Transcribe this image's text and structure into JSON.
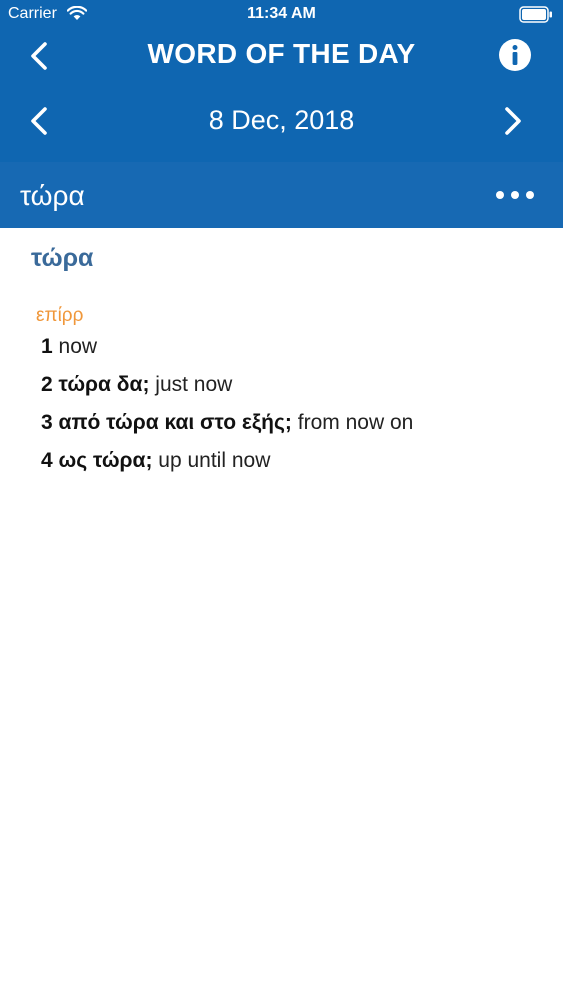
{
  "status_bar": {
    "carrier": "Carrier",
    "time": "11:34 AM"
  },
  "nav": {
    "title": "WORD OF THE DAY",
    "back_icon": "chevron-left-icon",
    "info_icon": "info-icon"
  },
  "date_nav": {
    "date": "8 Dec, 2018",
    "prev_icon": "chevron-left-icon",
    "next_icon": "chevron-right-icon"
  },
  "word_bar": {
    "title": "τώρα",
    "more_icon": "ellipsis-icon"
  },
  "entry": {
    "headword": "τώρα",
    "part_of_speech": "επίρρ",
    "senses": [
      {
        "number": "1",
        "phrase": "",
        "gloss": "now"
      },
      {
        "number": "2",
        "phrase": "τώρα δα;",
        "gloss": "just now"
      },
      {
        "number": "3",
        "phrase": "από τώρα και στο εξής;",
        "gloss": "from now on"
      },
      {
        "number": "4",
        "phrase": "ως τώρα;",
        "gloss": "up until now"
      }
    ]
  },
  "colors": {
    "header": "#0f66b1",
    "word_bar": "#1769b3",
    "headword": "#3a6a9a",
    "part_of_speech": "#f0973a"
  }
}
